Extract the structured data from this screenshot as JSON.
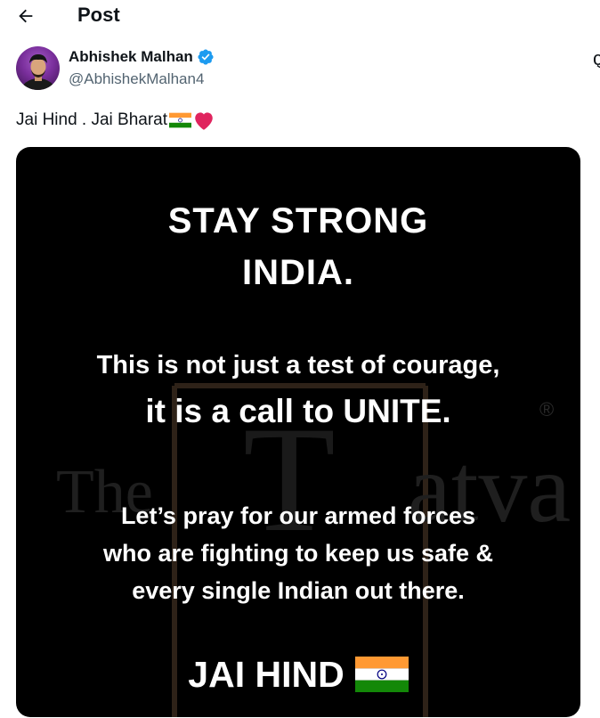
{
  "header": {
    "title": "Post",
    "back_icon": "arrow-left-icon"
  },
  "author": {
    "display_name": "Abhishek Malhan",
    "handle": "@AbhishekMalhan4",
    "verified_icon": "verified-badge-icon",
    "verified_color": "#1d9bf0"
  },
  "post": {
    "text": "Jai Hind . Jai Bharat",
    "emojis": [
      "india-flag-icon",
      "red-heart-icon"
    ]
  },
  "media": {
    "background": "#000000",
    "heading_line1": "STAY STRONG",
    "heading_line2": "INDIA.",
    "line3": "This is not just a test of courage,",
    "line4": "it is a call to UNITE.",
    "line5": "Let’s pray for our armed forces",
    "line6": "who are fighting to keep us safe &",
    "line7": "every single Indian out there.",
    "closing": "JAI HIND",
    "watermark_left": "The",
    "watermark_right": "atva",
    "watermark_mark": "®"
  },
  "colors": {
    "text": "#0f1419",
    "secondary": "#536471",
    "saffron": "#ff9933",
    "green": "#138808",
    "chakra": "#000080"
  }
}
